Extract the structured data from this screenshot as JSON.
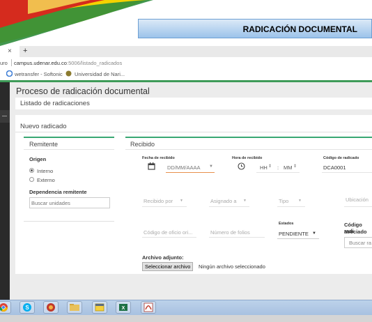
{
  "banner": {
    "title": "RADICACIÓN DOCUMENTAL"
  },
  "browser": {
    "tab_close": "×",
    "new_tab": "+",
    "address_prefix": "uro",
    "address": "campus.udenar.edu.co",
    "address_path": ":5006/listado_radicados",
    "bookmarks": [
      "wetransfer - Softonic",
      "Universidad de Nari..."
    ]
  },
  "header": {
    "title": "Proceso de radicación documental",
    "subtitle": "Listado de radicaciones"
  },
  "card": {
    "title": "Nuevo radicado"
  },
  "remitente": {
    "title": "Remitente",
    "origen_label": "Origen",
    "options": [
      "Interno",
      "Externo"
    ],
    "selected": "Interno",
    "dependencia_label": "Dependencia remitente",
    "search_placeholder": "Buscar unidades"
  },
  "recibido": {
    "title": "Recibido",
    "fecha_label": "Fecha de recibido",
    "fecha_placeholder": "DD/MM/AAAA",
    "hora_label": "Hora de recibido",
    "hora_hh": "HH",
    "hora_sep": ":",
    "hora_mm": "MM",
    "codigo_label": "Código de radicado",
    "codigo_value": "DCA0001",
    "recibido_por": "Recibido por",
    "asignado_a": "Asignado a",
    "tipo": "Tipo",
    "ubicacion": "Ubicación",
    "codigo_oficio": "Código de oficio ori...",
    "numero_folios": "Número de folios",
    "estados_label": "Estados",
    "estado_value": "PENDIENTE",
    "codigo_asociado_label": "Código radi",
    "codigo_asociado_label2": "asociado",
    "buscar_asociado": "Buscar ra",
    "archivo_label": "Archivo adjunto:",
    "archivo_button": "Seleccionar archivo",
    "archivo_status": "Ningún archivo seleccionado"
  },
  "taskbar": {
    "icons": [
      "chrome-icon",
      "skype-icon",
      "network-icon",
      "folder-icon",
      "calendar-icon",
      "excel-icon",
      "pdf-icon"
    ]
  }
}
